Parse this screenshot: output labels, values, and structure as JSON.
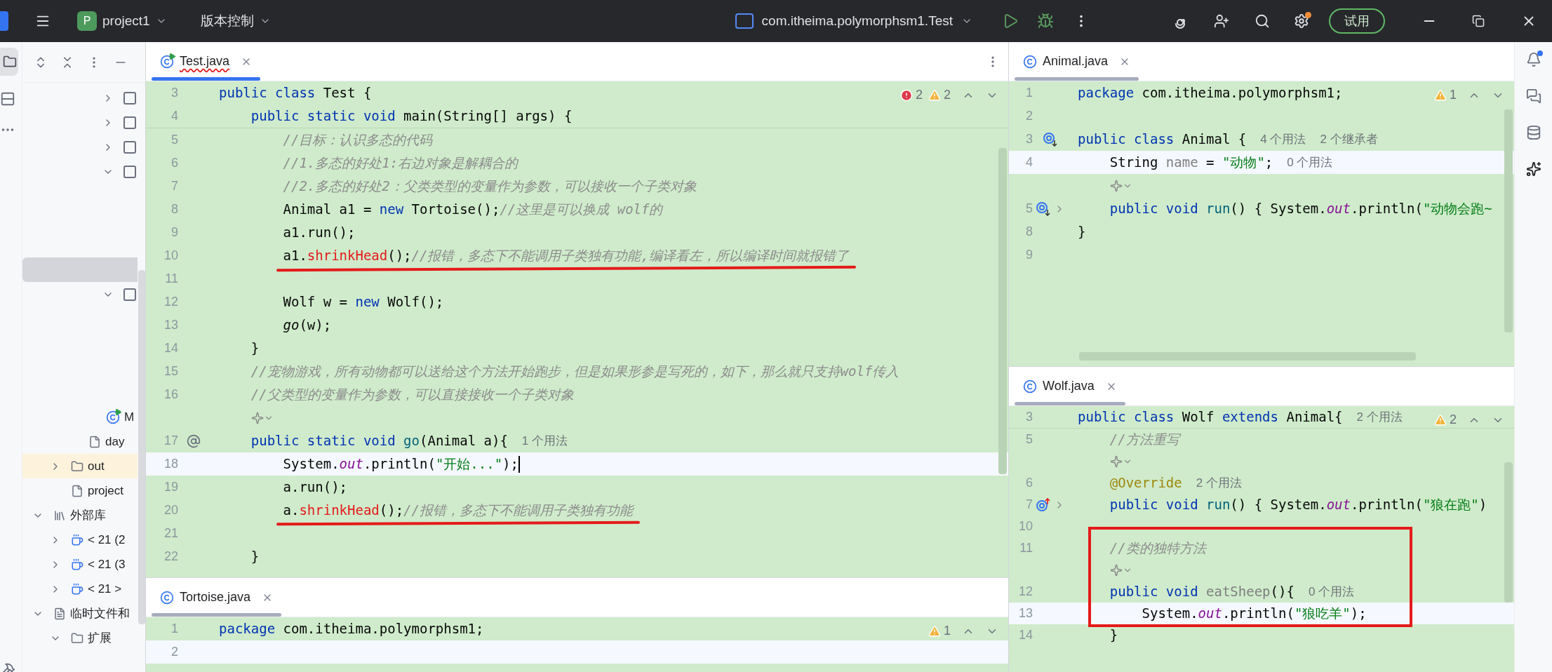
{
  "title_bar": {
    "project_initial": "P",
    "project": "project1",
    "vcs": "版本控制",
    "run_config": "com.itheima.polymorphsm1.Test",
    "trial_button": "试用"
  },
  "project_tree": [
    {
      "kind": "offscreen",
      "children": [
        {
          "kind": "offscreen",
          "children": [
            {
              "kind": "offscreen",
              "children": [
                {
                  "kind": "offscreen",
                  "children": [
                    {
                      "kind": "module",
                      "expanded": false,
                      "selected": false
                    },
                    {
                      "kind": "module",
                      "expanded": false,
                      "selected": false
                    },
                    {
                      "kind": "module",
                      "expanded": false,
                      "selected": false
                    },
                    {
                      "kind": "module",
                      "expanded": true,
                      "selected": false,
                      "children": [
                        {
                          "kind": "blank",
                          "selected": false
                        },
                        {
                          "kind": "blank",
                          "selected": false
                        },
                        {
                          "kind": "blank",
                          "selected": false
                        },
                        {
                          "kind": "blank",
                          "selected": true
                        }
                      ]
                    },
                    {
                      "kind": "module",
                      "expanded": true,
                      "selected": false,
                      "children": [
                        {
                          "kind": "blank",
                          "selected": false
                        },
                        {
                          "kind": "blank",
                          "selected": false
                        },
                        {
                          "kind": "blank",
                          "selected": false
                        },
                        {
                          "kind": "blank",
                          "selected": false
                        }
                      ]
                    }
                  ]
                },
                {
                  "kind": "runnable",
                  "label": "M",
                  "selected": false
                }
              ]
            },
            {
              "kind": "file",
              "label": "day",
              "selected": false
            }
          ]
        },
        {
          "kind": "folder",
          "label": "out",
          "expanded": false,
          "selected": false,
          "excluded": true
        },
        {
          "kind": "file",
          "label": "project",
          "selected": false
        }
      ]
    },
    {
      "kind": "library",
      "label": "外部库",
      "expanded": true,
      "selected": false,
      "children": [
        {
          "kind": "jdk",
          "label": "< 21 (2",
          "expanded": false,
          "selected": false
        },
        {
          "kind": "jdk",
          "label": "< 21 (3",
          "expanded": false,
          "selected": false
        },
        {
          "kind": "jdk",
          "label": "< 21 >",
          "expanded": false,
          "selected": false
        }
      ]
    },
    {
      "kind": "scratch",
      "label": "临时文件和",
      "expanded": true,
      "selected": false,
      "children": [
        {
          "kind": "folder",
          "label": "扩展",
          "expanded": true,
          "selected": false,
          "excluded": false
        }
      ]
    }
  ],
  "editors": {
    "test": {
      "focused": true,
      "tab": {
        "label": "Test.java",
        "kind": "runnable",
        "selected": true,
        "has_errors": true
      },
      "inspection": {
        "errors": "2",
        "warnings": "2"
      },
      "sticky": [
        {
          "kind": "code",
          "num": "3",
          "current": false,
          "underlined": false,
          "tokens": [
            {
              "kind": "kw",
              "text": "public class "
            },
            {
              "kind": "p",
              "text": "Test {"
            }
          ]
        },
        {
          "kind": "code",
          "num": "4",
          "current": false,
          "underlined": false,
          "tokens": [
            {
              "kind": "kw",
              "text": "    public static void "
            },
            {
              "kind": "p",
              "text": "main(String[] args) {"
            }
          ]
        }
      ],
      "lines": [
        {
          "kind": "code",
          "num": "5",
          "current": false,
          "underlined": false,
          "tokens": [
            {
              "kind": "c",
              "text": "        //目标：认识多态的代码"
            }
          ]
        },
        {
          "kind": "code",
          "num": "6",
          "current": false,
          "underlined": false,
          "tokens": [
            {
              "kind": "c",
              "text": "        //1.多态的好处1:右边对象是解耦合的"
            }
          ]
        },
        {
          "kind": "code",
          "num": "7",
          "current": false,
          "underlined": false,
          "tokens": [
            {
              "kind": "c",
              "text": "        //2.多态的好处2：父类类型的变量作为参数，可以接收一个子类对象"
            }
          ]
        },
        {
          "kind": "code",
          "num": "8",
          "current": false,
          "underlined": false,
          "tokens": [
            {
              "kind": "p",
              "text": "        Animal a1 = "
            },
            {
              "kind": "kw",
              "text": "new "
            },
            {
              "kind": "p",
              "text": "Tortoise();"
            },
            {
              "kind": "c",
              "text": "//这里是可以换成 wolf的"
            }
          ]
        },
        {
          "kind": "code",
          "num": "9",
          "current": false,
          "underlined": false,
          "tokens": [
            {
              "kind": "p",
              "text": "        a1.run();"
            }
          ]
        },
        {
          "kind": "code",
          "num": "10",
          "current": false,
          "underlined": true,
          "tokens": [
            {
              "kind": "p",
              "text": "        a1."
            },
            {
              "kind": "e",
              "text": "shrinkHead"
            },
            {
              "kind": "p",
              "text": "();"
            },
            {
              "kind": "c",
              "text": "//报错，多态下不能调用子类独有功能,编译看左，所以编译时间就报错了"
            }
          ]
        },
        {
          "kind": "code",
          "num": "11",
          "current": false
        },
        {
          "kind": "code",
          "num": "12",
          "current": false,
          "underlined": false,
          "tokens": [
            {
              "kind": "p",
              "text": "        Wolf w = "
            },
            {
              "kind": "kw",
              "text": "new "
            },
            {
              "kind": "p",
              "text": "Wolf();"
            }
          ]
        },
        {
          "kind": "code",
          "num": "13",
          "current": false,
          "underlined": false,
          "tokens": [
            {
              "kind": "m",
              "text": "        go"
            },
            {
              "kind": "p",
              "text": "(w);"
            }
          ]
        },
        {
          "kind": "code",
          "num": "14",
          "current": false,
          "underlined": false,
          "tokens": [
            {
              "kind": "p",
              "text": "    }"
            }
          ]
        },
        {
          "kind": "code",
          "num": "15",
          "current": false,
          "underlined": false,
          "tokens": [
            {
              "kind": "c",
              "text": "    //宠物游戏，所有动物都可以送给这个方法开始跑步，但是如果形参是写死的，如下，那么就只支持wolf传入"
            }
          ]
        },
        {
          "kind": "code",
          "num": "16",
          "current": false,
          "underlined": false,
          "tokens": [
            {
              "kind": "c",
              "text": "    //父类型的变量作为参数，可以直接接收一个子类对象"
            }
          ]
        },
        {
          "kind": "ai",
          "current": false
        },
        {
          "kind": "code",
          "num": "17",
          "gutter": {
            "kind": "at"
          },
          "current": false,
          "underlined": false,
          "tokens": [
            {
              "kind": "kw",
              "text": "    public static void "
            },
            {
              "kind": "fn",
              "text": "go"
            },
            {
              "kind": "p",
              "text": "(Animal a){"
            },
            {
              "kind": "hint",
              "text": "1 个用法"
            }
          ]
        },
        {
          "kind": "code",
          "num": "18",
          "current": true,
          "underlined": false,
          "tokens": [
            {
              "kind": "p",
              "text": "        System."
            },
            {
              "kind": "f",
              "text": "out"
            },
            {
              "kind": "p",
              "text": ".println("
            },
            {
              "kind": "s",
              "text": "\"开始...\""
            },
            {
              "kind": "p",
              "text": ");"
            }
          ]
        },
        {
          "kind": "code",
          "num": "19",
          "current": false,
          "underlined": false,
          "tokens": [
            {
              "kind": "p",
              "text": "        a.run();"
            }
          ]
        },
        {
          "kind": "code",
          "num": "20",
          "current": false,
          "underlined": true,
          "tokens": [
            {
              "kind": "p",
              "text": "        a."
            },
            {
              "kind": "e",
              "text": "shrinkHead"
            },
            {
              "kind": "p",
              "text": "();"
            },
            {
              "kind": "c",
              "text": "//报错，多态下不能调用子类独有功能"
            }
          ]
        },
        {
          "kind": "code",
          "num": "21",
          "current": false
        },
        {
          "kind": "code",
          "num": "22",
          "current": false,
          "underlined": false,
          "tokens": [
            {
              "kind": "p",
              "text": "    }"
            }
          ]
        }
      ]
    },
    "tortoise": {
      "focused": false,
      "tab": {
        "label": "Tortoise.java",
        "kind": "class",
        "selected": true,
        "has_errors": false
      },
      "inspection": {
        "warnings": "1"
      },
      "lines": [
        {
          "kind": "code",
          "num": "1",
          "current": false,
          "tokens": [
            {
              "kind": "kw",
              "text": "package "
            },
            {
              "kind": "p",
              "text": "com.itheima.polymorphsm1;"
            }
          ]
        },
        {
          "kind": "code",
          "num": "2",
          "current": true
        }
      ]
    },
    "animal": {
      "focused": false,
      "tab": {
        "label": "Animal.java",
        "kind": "class",
        "selected": true,
        "has_errors": false
      },
      "inspection": {
        "warnings": "1"
      },
      "lines": [
        {
          "kind": "code",
          "num": "1",
          "current": false,
          "tokens": [
            {
              "kind": "kw",
              "text": "package "
            },
            {
              "kind": "p",
              "text": "com.itheima.polymorphsm1;"
            }
          ]
        },
        {
          "kind": "code",
          "num": "2",
          "current": false
        },
        {
          "kind": "code",
          "num": "3",
          "gutter": {
            "kind": "implemented"
          },
          "current": false,
          "tokens": [
            {
              "kind": "kw",
              "text": "public class "
            },
            {
              "kind": "p",
              "text": "Animal {"
            },
            {
              "kind": "hint",
              "text": "4 个用法"
            },
            {
              "kind": "hint",
              "text": "2 个继承者"
            }
          ]
        },
        {
          "kind": "code",
          "num": "4",
          "current": true,
          "tokens": [
            {
              "kind": "p",
              "text": "    String "
            },
            {
              "kind": "d",
              "text": "name"
            },
            {
              "kind": "p",
              "text": " = "
            },
            {
              "kind": "s",
              "text": "\"动物\""
            },
            {
              "kind": "p",
              "text": ";"
            },
            {
              "kind": "hint",
              "text": "0 个用法"
            }
          ]
        },
        {
          "kind": "ai",
          "current": false
        },
        {
          "kind": "code",
          "num": "5",
          "gutter": {
            "kind": "implemented"
          },
          "folded": true,
          "current": false,
          "tokens": [
            {
              "kind": "kw",
              "text": "    public void "
            },
            {
              "kind": "fn",
              "text": "run"
            },
            {
              "kind": "p",
              "text": "() { System."
            },
            {
              "kind": "f",
              "text": "out"
            },
            {
              "kind": "p",
              "text": ".println("
            },
            {
              "kind": "s",
              "text": "\"动物会跑~"
            }
          ]
        },
        {
          "kind": "code",
          "num": "8",
          "current": false,
          "tokens": [
            {
              "kind": "p",
              "text": "}"
            }
          ]
        },
        {
          "kind": "code",
          "num": "9",
          "current": false
        }
      ]
    },
    "wolf": {
      "focused": false,
      "tab": {
        "label": "Wolf.java",
        "kind": "class",
        "selected": true,
        "has_errors": false
      },
      "inspection": {
        "warnings": "2"
      },
      "sticky": [
        {
          "kind": "code",
          "num": "3",
          "current": false,
          "tokens": [
            {
              "kind": "kw",
              "text": "public class "
            },
            {
              "kind": "p",
              "text": "Wolf "
            },
            {
              "kind": "kw",
              "text": "extends "
            },
            {
              "kind": "p",
              "text": "Animal{"
            },
            {
              "kind": "hint",
              "text": "2 个用法"
            }
          ]
        }
      ],
      "lines": [
        {
          "kind": "code",
          "num": "5",
          "current": false,
          "tokens": [
            {
              "kind": "c",
              "text": "    //方法重写"
            }
          ]
        },
        {
          "kind": "ai",
          "current": false
        },
        {
          "kind": "code",
          "num": "6",
          "current": false,
          "tokens": [
            {
              "kind": "a",
              "text": "    @Override"
            },
            {
              "kind": "hint",
              "text": "2 个用法"
            }
          ]
        },
        {
          "kind": "code",
          "num": "7",
          "gutter": {
            "kind": "overrides"
          },
          "folded": true,
          "current": false,
          "tokens": [
            {
              "kind": "kw",
              "text": "    public void "
            },
            {
              "kind": "fn",
              "text": "run"
            },
            {
              "kind": "p",
              "text": "() { System."
            },
            {
              "kind": "f",
              "text": "out"
            },
            {
              "kind": "p",
              "text": ".println("
            },
            {
              "kind": "s",
              "text": "\"狼在跑\""
            },
            {
              "kind": "p",
              "text": ")"
            }
          ]
        },
        {
          "kind": "code",
          "num": "10",
          "current": false
        },
        {
          "kind": "framed",
          "children": [
            {
              "kind": "code",
              "num": "11",
              "current": false,
              "tokens": [
                {
                  "kind": "c",
                  "text": "    //类的独特方法"
                }
              ]
            },
            {
              "kind": "ai",
              "current": false
            },
            {
              "kind": "code",
              "num": "12",
              "current": false,
              "tokens": [
                {
                  "kind": "kw",
                  "text": "    public void "
                },
                {
                  "kind": "d",
                  "text": "eatSheep"
                },
                {
                  "kind": "p",
                  "text": "(){"
                },
                {
                  "kind": "hint",
                  "text": "0 个用法"
                }
              ]
            },
            {
              "kind": "code",
              "num": "13",
              "current": true,
              "tokens": [
                {
                  "kind": "p",
                  "text": "        System."
                },
                {
                  "kind": "f",
                  "text": "out"
                },
                {
                  "kind": "p",
                  "text": ".println("
                },
                {
                  "kind": "s",
                  "text": "\"狼吃羊\""
                },
                {
                  "kind": "p",
                  "text": ");"
                }
              ]
            }
          ]
        },
        {
          "kind": "code",
          "num": "14",
          "current": false,
          "tokens": [
            {
              "kind": "p",
              "text": "    }"
            }
          ]
        }
      ]
    }
  }
}
